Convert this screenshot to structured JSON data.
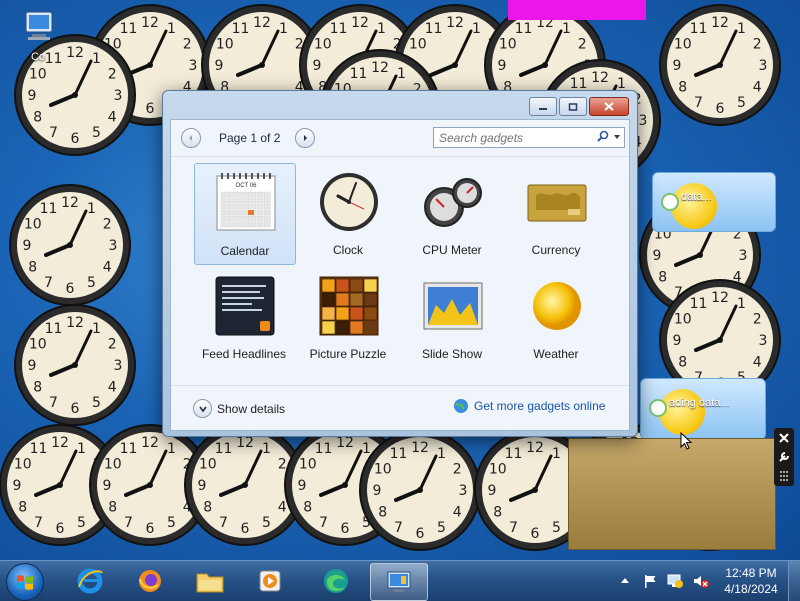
{
  "desktop": {
    "icon_label": "Co",
    "colors": {
      "magenta": "#ea16ea",
      "clock_face": "#f3ecd8"
    }
  },
  "side_widgets": [
    {
      "text": "data..."
    },
    {
      "text": "ading data..."
    }
  ],
  "gallery": {
    "window_buttons": [
      "minimize",
      "maximize",
      "close"
    ],
    "page_label": "Page 1 of 2",
    "search_placeholder": "Search gadgets",
    "gadgets": [
      {
        "name": "Calendar",
        "icon": "calendar-icon",
        "selected": true,
        "calendar_month": "OCT 06"
      },
      {
        "name": "Clock",
        "icon": "clock-icon",
        "selected": false
      },
      {
        "name": "CPU Meter",
        "icon": "cpu-meter-icon",
        "selected": false
      },
      {
        "name": "Currency",
        "icon": "currency-icon",
        "selected": false
      },
      {
        "name": "Feed Headlines",
        "icon": "feed-icon",
        "selected": false
      },
      {
        "name": "Picture Puzzle",
        "icon": "puzzle-icon",
        "selected": false
      },
      {
        "name": "Slide Show",
        "icon": "slideshow-icon",
        "selected": false
      },
      {
        "name": "Weather",
        "icon": "weather-icon",
        "selected": false
      }
    ],
    "show_details_label": "Show details",
    "get_more_label": "Get more gadgets online"
  },
  "taskbar": {
    "apps": [
      "ie-icon",
      "firefox-icon",
      "explorer-icon",
      "media-player-icon",
      "edge-icon",
      "gadgets-icon"
    ],
    "time": "12:48 PM",
    "date": "4/18/2024"
  }
}
